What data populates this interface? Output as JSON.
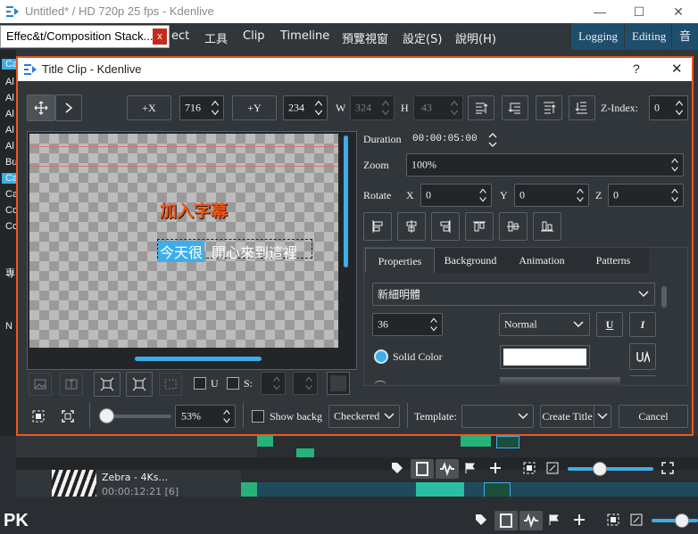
{
  "app": {
    "title": "Untitled* / HD 720p 25 fps - Kdenlive",
    "window_controls": [
      "—",
      "☐",
      "✕"
    ]
  },
  "menubar": {
    "items": [
      "ect",
      "工具",
      "Clip",
      "Timeline",
      "預覽視窗",
      "設定(S)",
      "說明(H)"
    ],
    "workspaces": [
      "Logging",
      "Editing",
      "音訊"
    ]
  },
  "effect_tab": {
    "label": "Effec&t/Composition Stack...",
    "close": "x"
  },
  "left_strip": {
    "items": [
      "Ca",
      "Al",
      "Al",
      "Al",
      "Al",
      "Al",
      "Bu",
      "Ca",
      "Ca",
      "Co",
      "Co",
      "專",
      "N"
    ]
  },
  "dialog": {
    "title": "Title Clip - Kdenlive",
    "help": "?",
    "close": "✕",
    "toolbar": {
      "plus_x": "+X",
      "x_value": "716",
      "plus_y": "+Y",
      "y_value": "234",
      "w_label": "W",
      "w_value": "324",
      "h_label": "H",
      "h_value": "43",
      "zindex_label": "Z-Index:",
      "zindex_value": "0"
    },
    "canvas": {
      "title_text": "加入字幕",
      "selected_text": "今天很",
      "rest_text": "開心來到這裡"
    },
    "props": {
      "duration_label": "Duration",
      "duration_value": "00:00:05:00",
      "zoom_label": "Zoom",
      "zoom_value": "100%",
      "rotate_label": "Rotate",
      "rx_label": "X",
      "rx_value": "0",
      "ry_label": "Y",
      "ry_value": "0",
      "rz_label": "Z",
      "rz_value": "0"
    },
    "tabs": [
      "Properties",
      "Background",
      "Animation",
      "Patterns"
    ],
    "font": {
      "family": "新細明體",
      "size": "36",
      "weight": "Normal",
      "underline": "U",
      "italic": "I",
      "solid_color_label": "Solid Color",
      "color": "#ffffff"
    },
    "left_tools": {
      "u_label": "U",
      "s_label": "S:"
    },
    "bottom": {
      "zoom_value": "53%",
      "show_bg_label": "Show backg",
      "bg_option": "Checkered",
      "template_label": "Template:",
      "template_value": "",
      "create_label": "Create Title",
      "cancel_label": "Cancel"
    }
  },
  "timeline": {
    "clip_name": "Zebra - 4Ks...",
    "clip_time": "00:00:12:21 [6]"
  },
  "watermark": {
    "text": "PK"
  },
  "colors": {
    "accent": "#3daee9",
    "dialog_border": "#f0561d",
    "title_text": "#f0561d",
    "clip_green": "#27b279"
  }
}
